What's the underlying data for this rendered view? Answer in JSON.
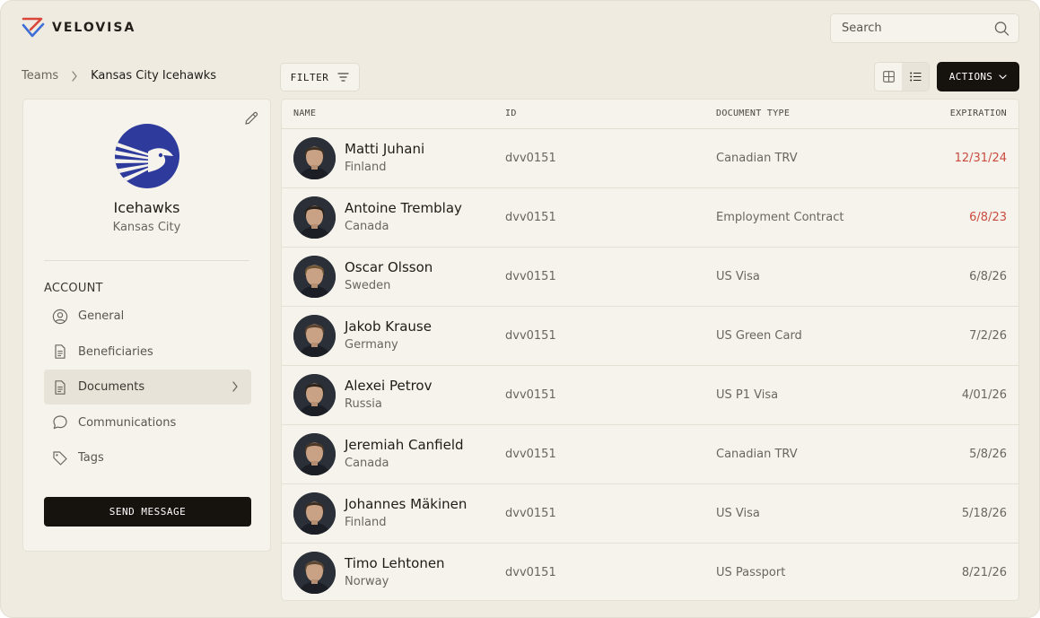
{
  "brand": {
    "name": "VELOVISA"
  },
  "search": {
    "placeholder": "Search"
  },
  "breadcrumb": {
    "parent": "Teams",
    "current": "Kansas City Icehawks"
  },
  "toolbar": {
    "filter_label": "FILTER",
    "actions_label": "ACTIONS",
    "view_mode": "list"
  },
  "team": {
    "name": "Icehawks",
    "city": "Kansas City",
    "section_label": "ACCOUNT",
    "nav": [
      {
        "label": "General",
        "icon": "user-circle-icon",
        "active": false
      },
      {
        "label": "Beneficiaries",
        "icon": "document-icon",
        "active": false
      },
      {
        "label": "Documents",
        "icon": "document-icon",
        "active": true
      },
      {
        "label": "Communications",
        "icon": "chat-bubble-icon",
        "active": false
      },
      {
        "label": "Tags",
        "icon": "tag-icon",
        "active": false
      }
    ],
    "send_message_label": "SEND MESSAGE"
  },
  "table": {
    "columns": {
      "name": "NAME",
      "id": "ID",
      "document_type": "DOCUMENT TYPE",
      "expiration": "EXPIRATION"
    },
    "rows": [
      {
        "name": "Matti Juhani",
        "country": "Finland",
        "id": "dvv0151",
        "document_type": "Canadian TRV",
        "expiration": "12/31/24",
        "expired": true
      },
      {
        "name": "Antoine Tremblay",
        "country": "Canada",
        "id": "dvv0151",
        "document_type": "Employment Contract",
        "expiration": "6/8/23",
        "expired": true
      },
      {
        "name": "Oscar Olsson",
        "country": "Sweden",
        "id": "dvv0151",
        "document_type": "US Visa",
        "expiration": "6/8/26",
        "expired": false
      },
      {
        "name": "Jakob Krause",
        "country": "Germany",
        "id": "dvv0151",
        "document_type": "US Green Card",
        "expiration": "7/2/26",
        "expired": false
      },
      {
        "name": "Alexei Petrov",
        "country": "Russia",
        "id": "dvv0151",
        "document_type": "US P1 Visa",
        "expiration": "4/01/26",
        "expired": false
      },
      {
        "name": "Jeremiah Canfield",
        "country": "Canada",
        "id": "dvv0151",
        "document_type": "Canadian TRV",
        "expiration": "5/8/26",
        "expired": false
      },
      {
        "name": "Johannes Mäkinen",
        "country": "Finland",
        "id": "dvv0151",
        "document_type": "US Visa",
        "expiration": "5/18/26",
        "expired": false
      },
      {
        "name": "Timo Lehtonen",
        "country": "Norway",
        "id": "dvv0151",
        "document_type": "US Passport",
        "expiration": "8/21/26",
        "expired": false
      }
    ]
  },
  "colors": {
    "expired": "#c94b40",
    "primary_dark": "#16130f",
    "brand_red": "#d9463a",
    "brand_blue": "#3f6fd6",
    "team_logo": "#2f3b9c"
  }
}
